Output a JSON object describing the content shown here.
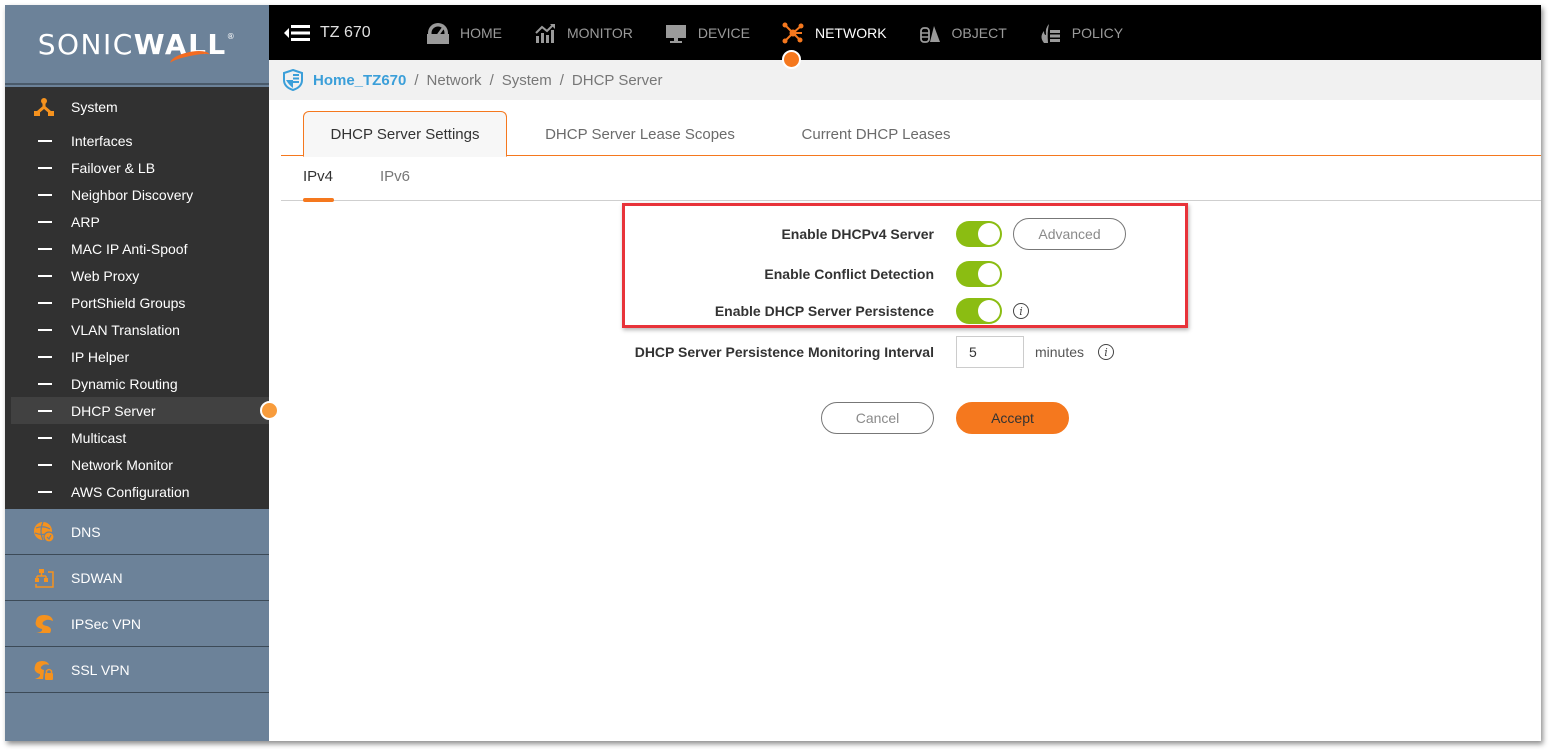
{
  "brand": {
    "logo_light": "SONIC",
    "logo_bold": "WALL",
    "logo_reg": "®"
  },
  "topbar": {
    "device_name": "TZ 670",
    "menu_icon": "menu-collapse-icon",
    "nav": [
      {
        "label": "HOME",
        "icon": "dashboard-gauge-icon",
        "active": false
      },
      {
        "label": "MONITOR",
        "icon": "chart-trend-icon",
        "active": false
      },
      {
        "label": "DEVICE",
        "icon": "monitor-icon",
        "active": false
      },
      {
        "label": "NETWORK",
        "icon": "network-nodes-icon",
        "active": true
      },
      {
        "label": "OBJECT",
        "icon": "object-shapes-icon",
        "active": false
      },
      {
        "label": "POLICY",
        "icon": "policy-firewall-icon",
        "active": false
      }
    ]
  },
  "breadcrumb": {
    "icon": "shield-firewall-icon",
    "home": "Home_TZ670",
    "separator": "/",
    "items": [
      "Network",
      "System",
      "DHCP Server"
    ]
  },
  "sidebar": {
    "system": {
      "label": "System",
      "icon": "system-nodes-icon",
      "items": [
        {
          "label": "Interfaces",
          "active": false
        },
        {
          "label": "Failover & LB",
          "active": false
        },
        {
          "label": "Neighbor Discovery",
          "active": false
        },
        {
          "label": "ARP",
          "active": false
        },
        {
          "label": "MAC IP Anti-Spoof",
          "active": false
        },
        {
          "label": "Web Proxy",
          "active": false
        },
        {
          "label": "PortShield Groups",
          "active": false
        },
        {
          "label": "VLAN Translation",
          "active": false
        },
        {
          "label": "IP Helper",
          "active": false
        },
        {
          "label": "Dynamic Routing",
          "active": false
        },
        {
          "label": "DHCP Server",
          "active": true
        },
        {
          "label": "Multicast",
          "active": false
        },
        {
          "label": "Network Monitor",
          "active": false
        },
        {
          "label": "AWS Configuration",
          "active": false
        }
      ]
    },
    "groups": [
      {
        "label": "DNS",
        "icon": "dns-globe-icon"
      },
      {
        "label": "SDWAN",
        "icon": "sdwan-hierarchy-icon"
      },
      {
        "label": "IPSec VPN",
        "icon": "ipsec-tunnel-icon"
      },
      {
        "label": "SSL VPN",
        "icon": "ssl-vpn-lock-icon"
      }
    ]
  },
  "tabs": [
    {
      "label": "DHCP Server Settings",
      "active": true
    },
    {
      "label": "DHCP Server Lease Scopes",
      "active": false
    },
    {
      "label": "Current DHCP Leases",
      "active": false
    }
  ],
  "subtabs": [
    {
      "label": "IPv4",
      "active": true
    },
    {
      "label": "IPv6",
      "active": false
    }
  ],
  "form": {
    "enable_dhcpv4": {
      "label": "Enable DHCPv4 Server",
      "enabled": true
    },
    "advanced_button": "Advanced",
    "conflict_detection": {
      "label": "Enable Conflict Detection",
      "enabled": true
    },
    "persistence": {
      "label": "Enable DHCP Server Persistence",
      "enabled": true
    },
    "interval": {
      "label": "DHCP Server Persistence Monitoring Interval",
      "value": "5",
      "units": "minutes"
    },
    "info_glyph": "i",
    "cancel_button": "Cancel",
    "accept_button": "Accept"
  },
  "colors": {
    "accent_orange": "#f5781e",
    "toggle_on": "#8bbd12",
    "link_blue": "#3b9fd9",
    "highlight_red": "#e8333a",
    "sidebar_blue": "#6c8299",
    "sidebar_dark": "#313131"
  }
}
